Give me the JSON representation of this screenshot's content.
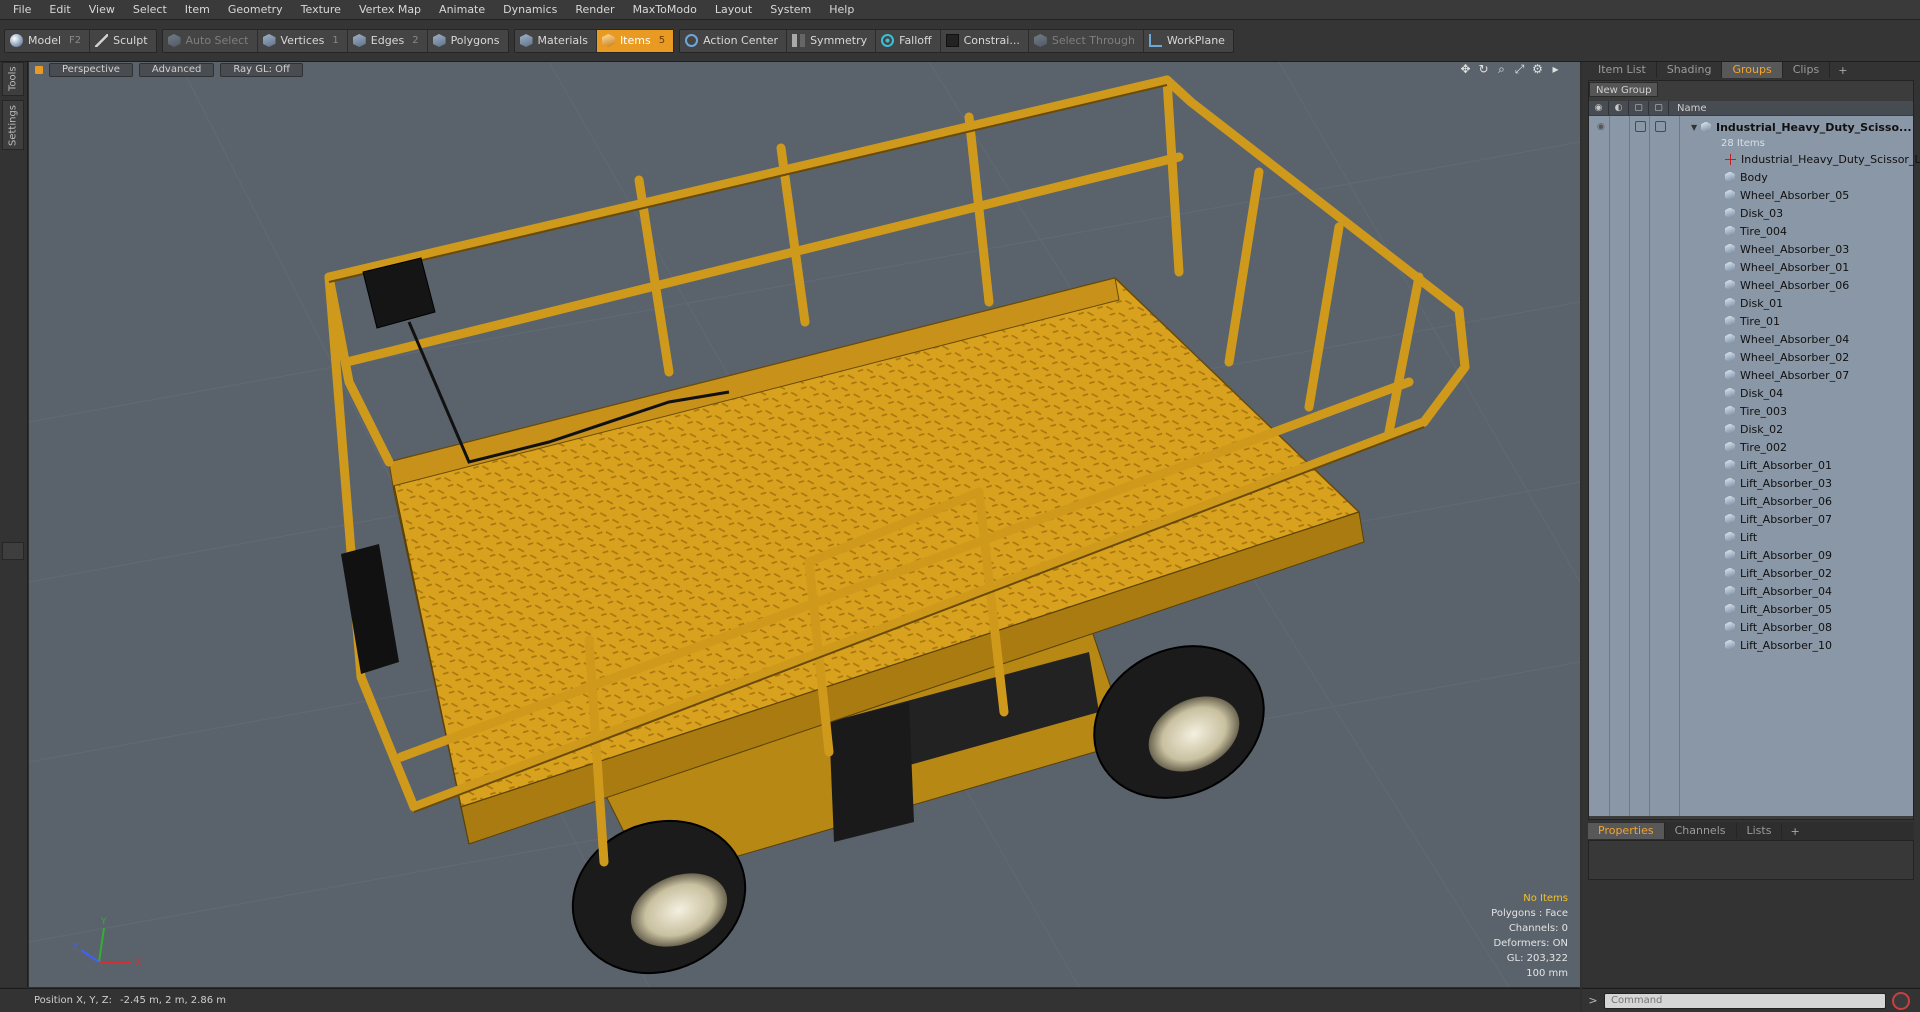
{
  "menu": [
    "File",
    "Edit",
    "View",
    "Select",
    "Item",
    "Geometry",
    "Texture",
    "Vertex Map",
    "Animate",
    "Dynamics",
    "Render",
    "MaxToModo",
    "Layout",
    "System",
    "Help"
  ],
  "toolbar": {
    "model_label": "Model",
    "model_key": "F2",
    "sculpt_label": "Sculpt",
    "auto_select_label": "Auto Select",
    "vertices_label": "Vertices",
    "vertices_key": "1",
    "edges_label": "Edges",
    "edges_key": "2",
    "polygons_label": "Polygons",
    "materials_label": "Materials",
    "items_label": "Items",
    "items_key": "5",
    "action_center_label": "Action Center",
    "symmetry_label": "Symmetry",
    "falloff_label": "Falloff",
    "constraints_label": "Constrai...",
    "select_through_label": "Select Through",
    "workplane_label": "WorkPlane"
  },
  "left_tabs": {
    "tools": "Tools",
    "settings": "Settings"
  },
  "viewport": {
    "tabs": [
      "Perspective",
      "Advanced",
      "Ray GL: Off"
    ],
    "info": {
      "selection": "No Items",
      "polygons": "Polygons : Face",
      "channels": "Channels: 0",
      "deformers": "Deformers: ON",
      "gl": "GL: 203,322",
      "scale": "100 mm"
    },
    "axis_labels": {
      "x": "X",
      "y": "Y",
      "z": "Z"
    }
  },
  "right_panel": {
    "tabs": [
      "Item List",
      "Shading",
      "Groups",
      "Clips"
    ],
    "active_tab": "Groups",
    "new_group_label": "New Group",
    "name_header": "Name",
    "group": {
      "name": "Industrial_Heavy_Duty_Scisso...",
      "count": "28 Items"
    },
    "items": [
      "Industrial_Heavy_Duty_Scissor_Lift",
      "Body",
      "Wheel_Absorber_05",
      "Disk_03",
      "Tire_004",
      "Wheel_Absorber_03",
      "Wheel_Absorber_01",
      "Wheel_Absorber_06",
      "Disk_01",
      "Tire_01",
      "Wheel_Absorber_04",
      "Wheel_Absorber_02",
      "Wheel_Absorber_07",
      "Disk_04",
      "Tire_003",
      "Disk_02",
      "Tire_002",
      "Lift_Absorber_01",
      "Lift_Absorber_03",
      "Lift_Absorber_06",
      "Lift_Absorber_07",
      "Lift",
      "Lift_Absorber_09",
      "Lift_Absorber_02",
      "Lift_Absorber_04",
      "Lift_Absorber_05",
      "Lift_Absorber_08",
      "Lift_Absorber_10"
    ],
    "properties_tabs": [
      "Properties",
      "Channels",
      "Lists"
    ],
    "properties_active": "Properties"
  },
  "status": {
    "position_label": "Position X, Y, Z:",
    "position_value": "-2.45 m, 2 m, 2.86 m"
  },
  "command": {
    "prompt": ">",
    "placeholder": "Command"
  },
  "colors": {
    "accent": "#e99a22",
    "viewport_bg": "#5a636b",
    "model_yellow": "#d9a21e"
  }
}
